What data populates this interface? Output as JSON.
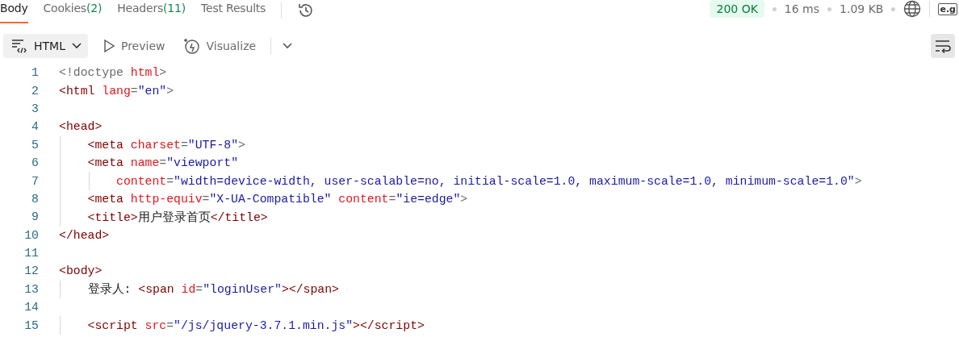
{
  "tabs": [
    {
      "label": "Body",
      "selected": true
    },
    {
      "label": "Cookies",
      "count": "(2)",
      "selected": false
    },
    {
      "label": "Headers",
      "count": "(11)",
      "selected": false
    },
    {
      "label": "Test Results",
      "selected": false
    }
  ],
  "status": {
    "code": "200 OK",
    "time": "16 ms",
    "size": "1.09 KB",
    "extra": "e.g"
  },
  "toolbar": {
    "format": "HTML",
    "preview": "Preview",
    "visualize": "Visualize",
    "wrap_on": true
  },
  "lines": [
    {
      "number": "1",
      "tokens": [
        {
          "kind": "punct",
          "text": "<!doctype "
        },
        {
          "kind": "attr",
          "text": "html"
        },
        {
          "kind": "punct",
          "text": ">"
        }
      ]
    },
    {
      "number": "2",
      "tokens": [
        {
          "kind": "tag",
          "text": "<html "
        },
        {
          "kind": "attr",
          "text": "lang"
        },
        {
          "kind": "punct",
          "text": "="
        },
        {
          "kind": "str",
          "text": "\"en\""
        },
        {
          "kind": "punct",
          "text": ">"
        }
      ]
    },
    {
      "number": "3"
    },
    {
      "number": "4",
      "tokens": [
        {
          "kind": "tag",
          "text": "<head>"
        }
      ]
    },
    {
      "number": "5",
      "tokens": [
        {
          "kind": "tag",
          "text": "    <meta "
        },
        {
          "kind": "attr",
          "text": "charset"
        },
        {
          "kind": "punct",
          "text": "="
        },
        {
          "kind": "str",
          "text": "\"UTF-8\""
        },
        {
          "kind": "punct",
          "text": ">"
        }
      ]
    },
    {
      "number": "6",
      "tokens": [
        {
          "kind": "tag",
          "text": "    <meta "
        },
        {
          "kind": "attr",
          "text": "name"
        },
        {
          "kind": "punct",
          "text": "="
        },
        {
          "kind": "str",
          "text": "\"viewport\""
        }
      ]
    },
    {
      "number": "7",
      "tokens": [
        {
          "kind": "attr",
          "text": "        content"
        },
        {
          "kind": "punct",
          "text": "="
        },
        {
          "kind": "str",
          "text": "\"width=device-width, user-scalable=no, initial-scale=1.0, maximum-scale=1.0, minimum-scale=1.0\""
        },
        {
          "kind": "punct",
          "text": ">"
        }
      ]
    },
    {
      "number": "8",
      "tokens": [
        {
          "kind": "tag",
          "text": "    <meta "
        },
        {
          "kind": "attr",
          "text": "http-equiv"
        },
        {
          "kind": "punct",
          "text": "="
        },
        {
          "kind": "str",
          "text": "\"X-UA-Compatible\" "
        },
        {
          "kind": "attr",
          "text": "content"
        },
        {
          "kind": "punct",
          "text": "="
        },
        {
          "kind": "str",
          "text": "\"ie=edge\""
        },
        {
          "kind": "punct",
          "text": ">"
        }
      ]
    },
    {
      "number": "9",
      "tokens": [
        {
          "kind": "tag",
          "text": "    <title>"
        },
        {
          "kind": "text",
          "text": "用户登录首页"
        },
        {
          "kind": "tag",
          "text": "</title>"
        }
      ]
    },
    {
      "number": "10",
      "tokens": [
        {
          "kind": "tag",
          "text": "</head>"
        }
      ]
    },
    {
      "number": "11"
    },
    {
      "number": "12",
      "tokens": [
        {
          "kind": "tag",
          "text": "<body>"
        }
      ]
    },
    {
      "number": "13",
      "tokens": [
        {
          "kind": "text",
          "text": "    登录人: "
        },
        {
          "kind": "tag",
          "text": "<span "
        },
        {
          "kind": "attr",
          "text": "id"
        },
        {
          "kind": "punct",
          "text": "="
        },
        {
          "kind": "str",
          "text": "\"loginUser\""
        },
        {
          "kind": "tag",
          "text": "></span>"
        }
      ]
    },
    {
      "number": "14"
    },
    {
      "number": "15",
      "tokens": [
        {
          "kind": "tag",
          "text": "    <script "
        },
        {
          "kind": "attr",
          "text": "src"
        },
        {
          "kind": "punct",
          "text": "="
        },
        {
          "kind": "str",
          "text": "\"/js/jquery-3.7.1.min.js\""
        },
        {
          "kind": "tag",
          "text": "></script>"
        }
      ]
    }
  ]
}
